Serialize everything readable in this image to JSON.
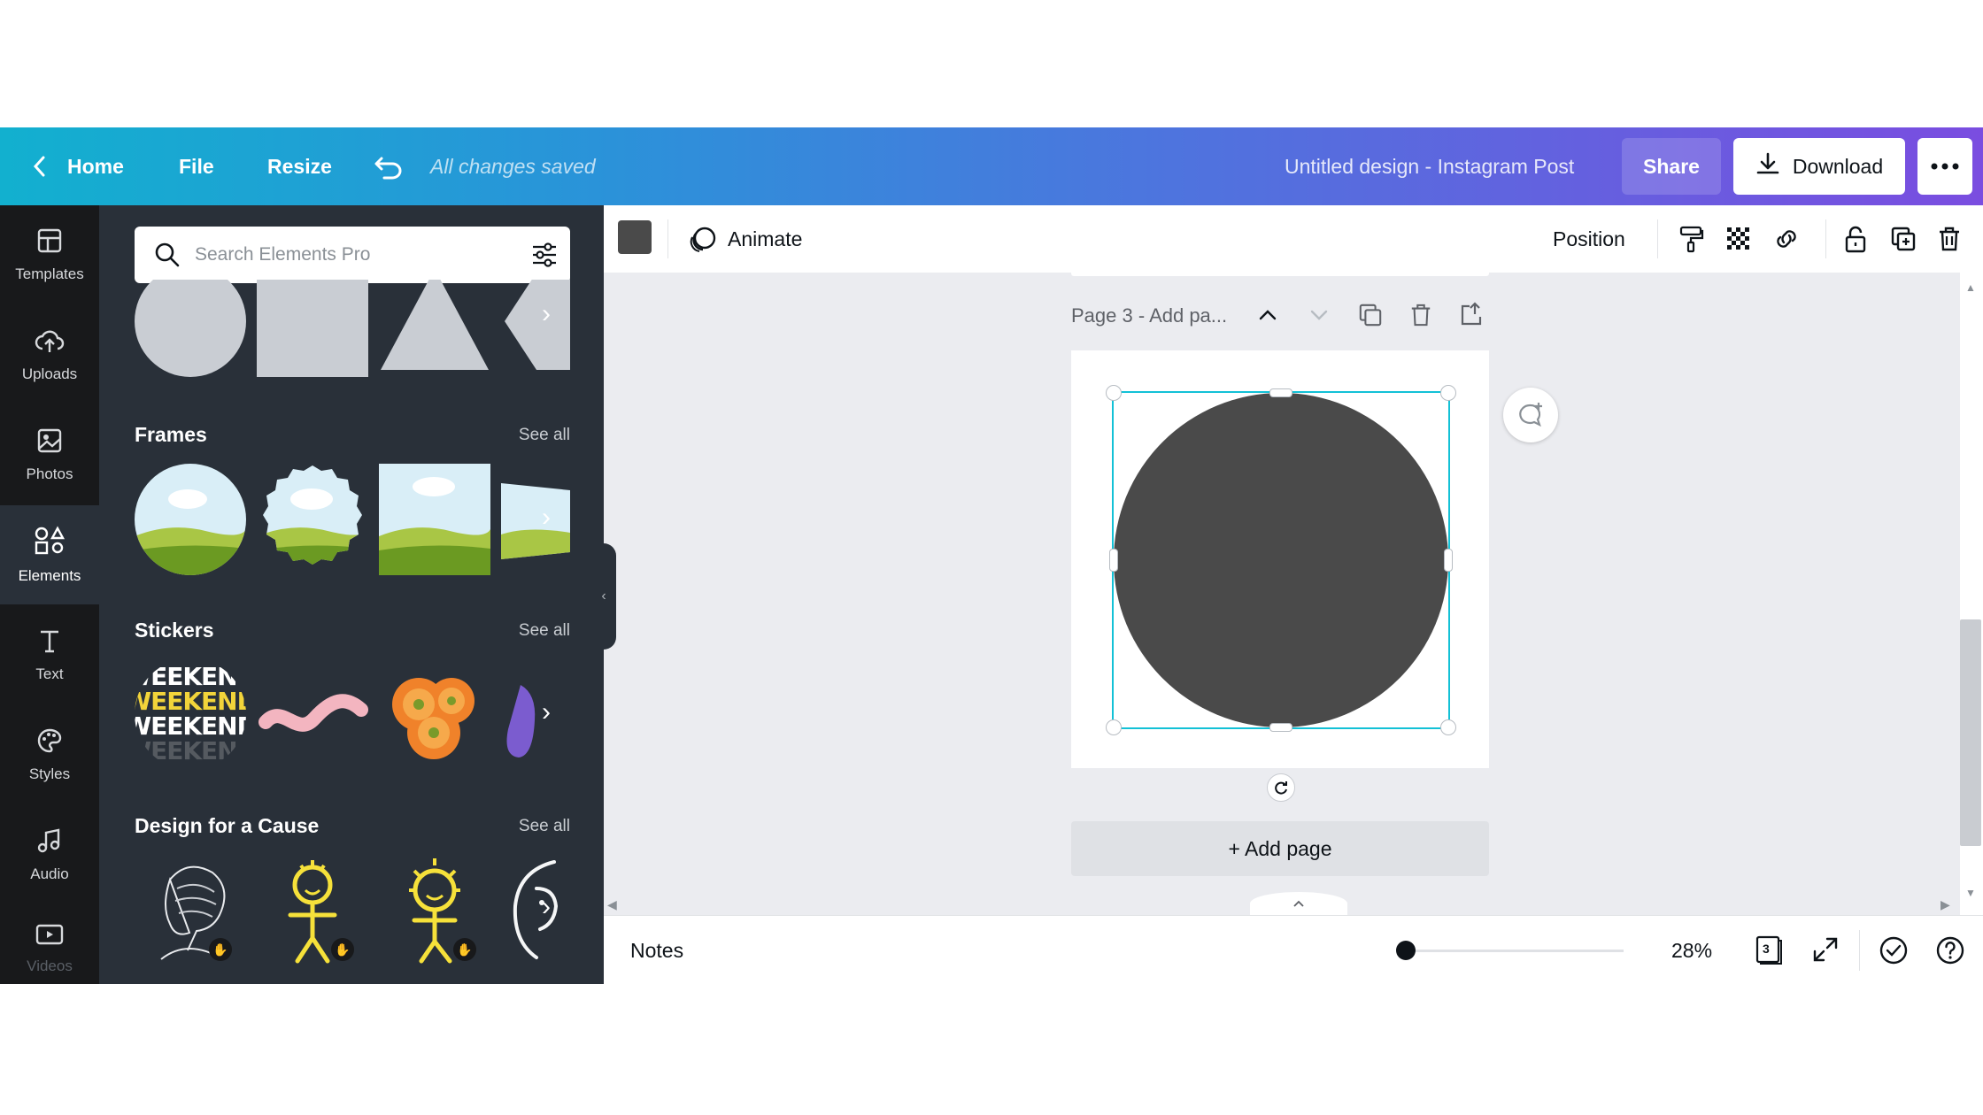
{
  "topbar": {
    "home_label": "Home",
    "file_label": "File",
    "resize_label": "Resize",
    "saved_status": "All changes saved",
    "design_title": "Untitled design - Instagram Post",
    "share_label": "Share",
    "download_label": "Download"
  },
  "rail": {
    "items": [
      {
        "label": "Templates",
        "icon": "templates-icon"
      },
      {
        "label": "Uploads",
        "icon": "upload-cloud-icon"
      },
      {
        "label": "Photos",
        "icon": "photo-icon"
      },
      {
        "label": "Elements",
        "icon": "shapes-icon"
      },
      {
        "label": "Text",
        "icon": "text-icon"
      },
      {
        "label": "Styles",
        "icon": "palette-icon"
      },
      {
        "label": "Audio",
        "icon": "music-icon"
      },
      {
        "label": "Videos",
        "icon": "video-icon"
      }
    ],
    "active": "Elements"
  },
  "panel": {
    "search_placeholder": "Search Elements Pro",
    "frames_title": "Frames",
    "stickers_title": "Stickers",
    "cause_title": "Design for a Cause",
    "see_all": "See all",
    "sticker_text": "WEEKEND"
  },
  "toolbar": {
    "fill_color": "#4a4a4a",
    "animate_label": "Animate",
    "position_label": "Position"
  },
  "canvas": {
    "page_label": "Page 3 - Add pa...",
    "add_page_label": "+ Add page",
    "selection_color": "#13c1d6"
  },
  "bottombar": {
    "notes_label": "Notes",
    "zoom_percent": "28%",
    "zoom_fraction": 0.04,
    "page_count": "3"
  }
}
